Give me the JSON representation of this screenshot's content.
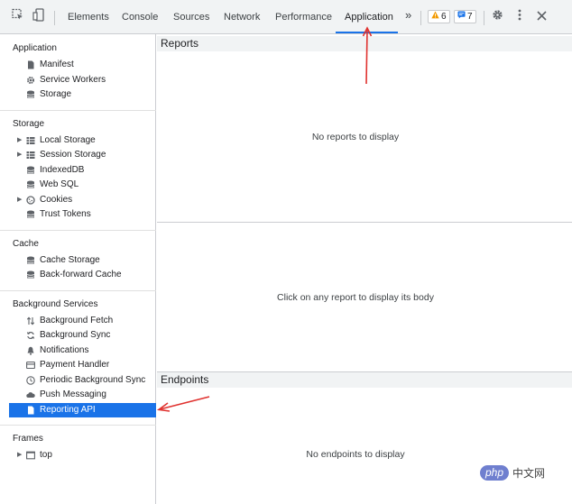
{
  "toolbar": {
    "tabs": [
      {
        "label": "Elements"
      },
      {
        "label": "Console"
      },
      {
        "label": "Sources"
      },
      {
        "label": "Network"
      },
      {
        "label": "Performance"
      },
      {
        "label": "Application"
      }
    ],
    "more_label": "»",
    "warnings_count": "6",
    "issues_count": "7"
  },
  "sidebar": {
    "application": {
      "title": "Application",
      "items": [
        {
          "label": "Manifest",
          "icon": "document-icon"
        },
        {
          "label": "Service Workers",
          "icon": "gear-icon"
        },
        {
          "label": "Storage",
          "icon": "database-icon"
        }
      ]
    },
    "storage": {
      "title": "Storage",
      "items": [
        {
          "label": "Local Storage",
          "icon": "grid-icon"
        },
        {
          "label": "Session Storage",
          "icon": "grid-icon"
        },
        {
          "label": "IndexedDB",
          "icon": "database-icon"
        },
        {
          "label": "Web SQL",
          "icon": "database-icon"
        },
        {
          "label": "Cookies",
          "icon": "cookie-icon"
        },
        {
          "label": "Trust Tokens",
          "icon": "database-icon"
        }
      ]
    },
    "cache": {
      "title": "Cache",
      "items": [
        {
          "label": "Cache Storage",
          "icon": "database-icon"
        },
        {
          "label": "Back-forward Cache",
          "icon": "database-icon"
        }
      ]
    },
    "background": {
      "title": "Background Services",
      "items": [
        {
          "label": "Background Fetch",
          "icon": "arrows-updown-icon"
        },
        {
          "label": "Background Sync",
          "icon": "sync-icon"
        },
        {
          "label": "Notifications",
          "icon": "bell-icon"
        },
        {
          "label": "Payment Handler",
          "icon": "card-icon"
        },
        {
          "label": "Periodic Background Sync",
          "icon": "clock-icon"
        },
        {
          "label": "Push Messaging",
          "icon": "cloud-icon"
        },
        {
          "label": "Reporting API",
          "icon": "document-icon"
        }
      ]
    },
    "frames": {
      "title": "Frames",
      "items": [
        {
          "label": "top",
          "icon": "frame-icon"
        }
      ]
    }
  },
  "main": {
    "reports_header": "Reports",
    "no_reports": "No reports to display",
    "click_report": "Click on any report to display its body",
    "endpoints_header": "Endpoints",
    "no_endpoints": "No endpoints to display"
  },
  "watermark": {
    "logo_text": "php",
    "site_text": "中文网"
  },
  "colors": {
    "accent": "#1a73e8",
    "annotation_arrow": "#e0322f"
  }
}
